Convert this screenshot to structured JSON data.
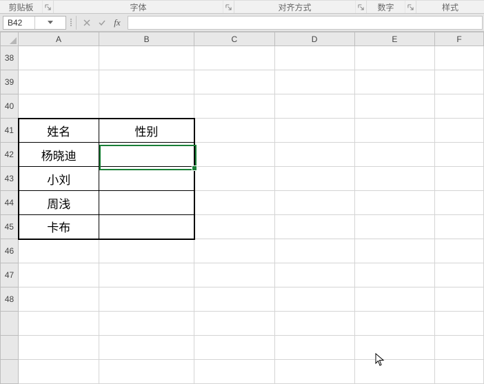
{
  "ribbon_groups": {
    "clipboard": "剪贴板",
    "font": "字体",
    "alignment": "对齐方式",
    "number": "数字",
    "styles": "样式"
  },
  "name_box": "B42",
  "formula_bar_value": "",
  "columns": [
    "A",
    "B",
    "C",
    "D",
    "E",
    "F"
  ],
  "row_numbers": [
    "38",
    "39",
    "40",
    "41",
    "42",
    "43",
    "44",
    "45",
    "46",
    "47",
    "48"
  ],
  "table": {
    "header": {
      "col1": "姓名",
      "col2": "性别"
    },
    "rows": [
      {
        "col1": "杨晓迪",
        "col2": ""
      },
      {
        "col1": "小刘",
        "col2": ""
      },
      {
        "col1": "周浅",
        "col2": ""
      },
      {
        "col1": "卡布",
        "col2": ""
      }
    ]
  },
  "active_cell": "B42",
  "chart_data": {
    "type": "table",
    "columns": [
      "姓名",
      "性别"
    ],
    "rows": [
      [
        "杨晓迪",
        ""
      ],
      [
        "小刘",
        ""
      ],
      [
        "周浅",
        ""
      ],
      [
        "卡布",
        ""
      ]
    ]
  }
}
